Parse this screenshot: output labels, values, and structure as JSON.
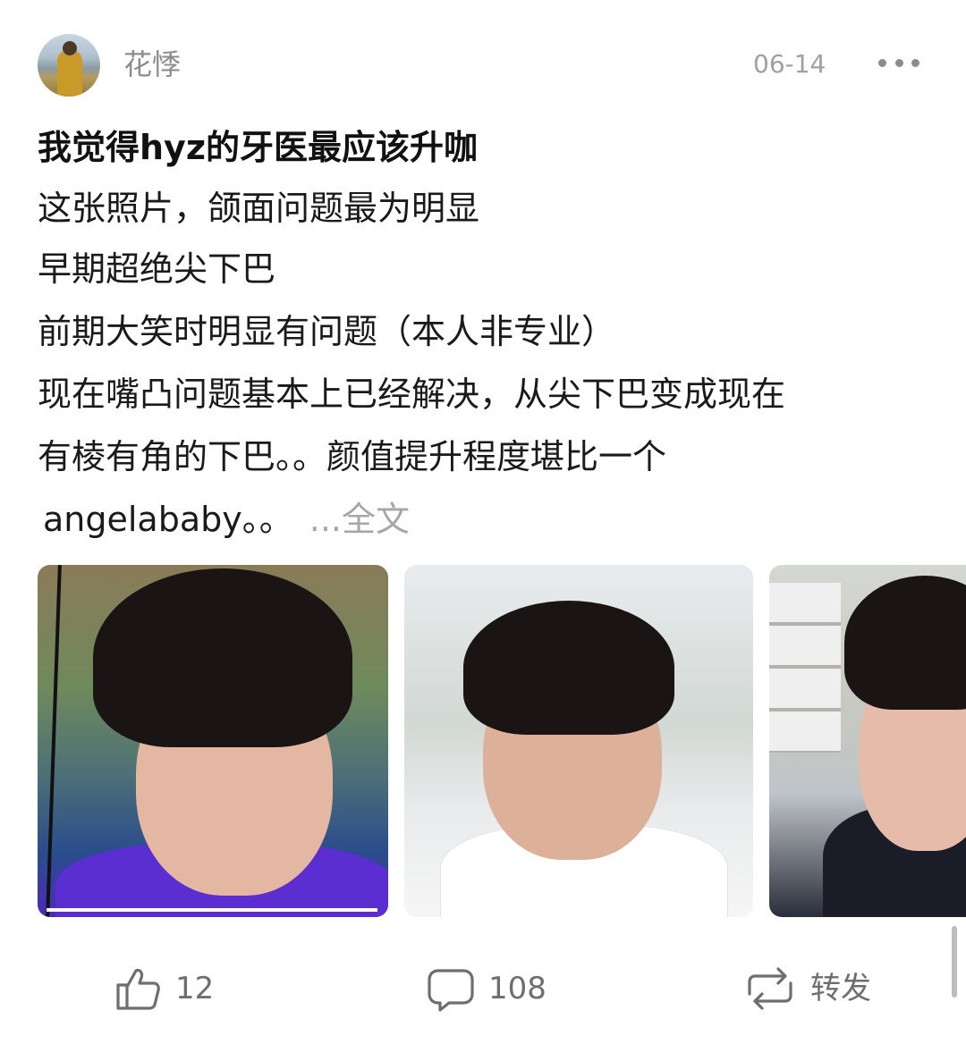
{
  "post": {
    "username": "花悸",
    "date": "06-14",
    "title": "我觉得hyz的牙医最应该升咖",
    "body_lines": [
      "这张照片，颌面问题最为明显",
      "早期超绝尖下巴",
      "前期大笑时明显有问题（本人非专业）",
      "现在嘴凸问题基本上已经解决，从尖下巴变成现在",
      "有棱有角的下巴。。颜值提升程度堪比一个",
      "angelababy。。"
    ],
    "more_link": "...全文"
  },
  "images": [
    {
      "name": "photo-1"
    },
    {
      "name": "photo-2"
    },
    {
      "name": "photo-3"
    }
  ],
  "actions": {
    "like_count": "12",
    "comment_count": "108",
    "repost_label": "转发"
  },
  "icons": {
    "more": "more-icon",
    "like": "thumbs-up-icon",
    "comment": "comment-bubble-icon",
    "repost": "repost-arrows-icon"
  },
  "colors": {
    "text_primary": "#111111",
    "text_secondary": "#8c8c8c",
    "link_muted": "#a6a6a6"
  }
}
